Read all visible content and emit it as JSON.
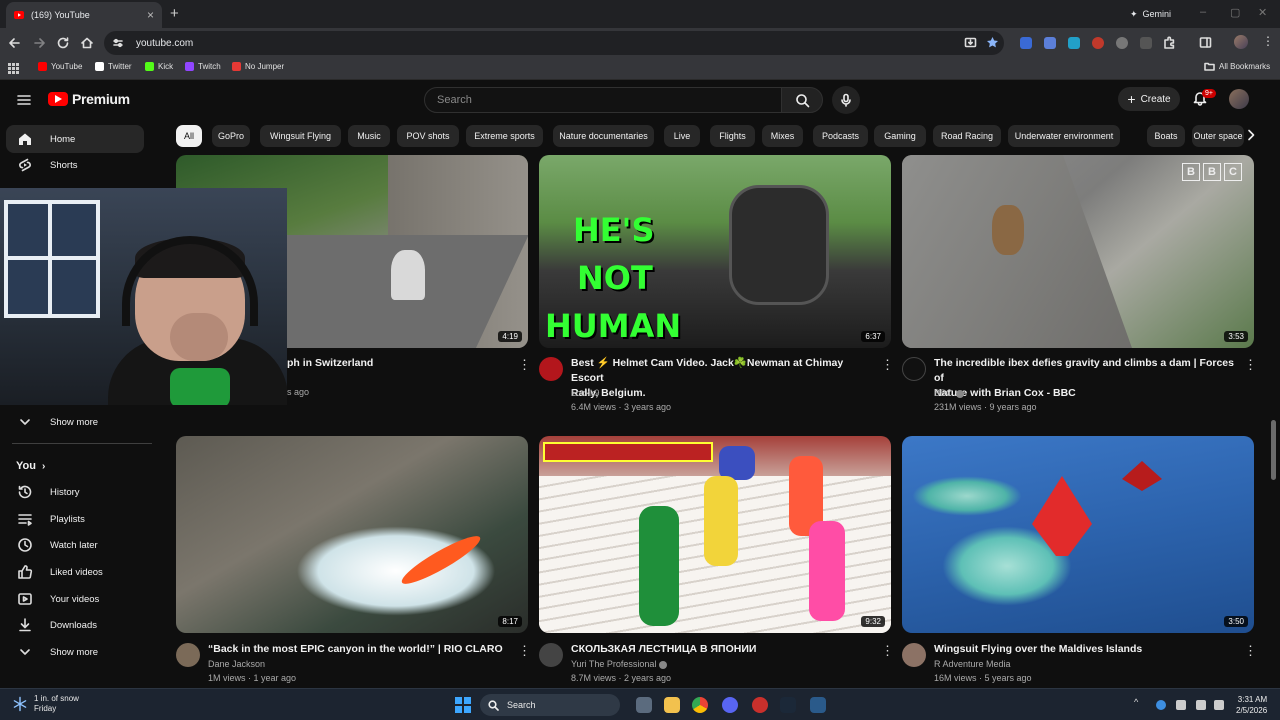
{
  "browser": {
    "tab_title": "(169) YouTube",
    "url": "youtube.com",
    "gemini_label": "Gemini",
    "bookmarks": [
      {
        "label": "YouTube",
        "color": "#ff0000"
      },
      {
        "label": "Twitter",
        "color": "#ffffff"
      },
      {
        "label": "Kick",
        "color": "#53fc18"
      },
      {
        "label": "Twitch",
        "color": "#9146ff"
      },
      {
        "label": "No Jumper",
        "color": "#e53935"
      }
    ],
    "all_bookmarks": "All Bookmarks"
  },
  "youtube": {
    "logo_text": "Premium",
    "search_placeholder": "Search",
    "create_label": "Create",
    "notification_count": "9+",
    "accent": "#ff0000"
  },
  "sidebar": {
    "top": [
      {
        "label": "Home",
        "icon": "home-icon"
      },
      {
        "label": "Shorts",
        "icon": "shorts-icon"
      }
    ],
    "show_more_1": "Show more",
    "you_label": "You",
    "you_items": [
      {
        "label": "History",
        "icon": "history-icon"
      },
      {
        "label": "Playlists",
        "icon": "playlists-icon"
      },
      {
        "label": "Watch later",
        "icon": "clock-icon"
      },
      {
        "label": "Liked videos",
        "icon": "thumbs-up-icon"
      },
      {
        "label": "Your videos",
        "icon": "video-icon"
      },
      {
        "label": "Downloads",
        "icon": "download-icon"
      }
    ],
    "show_more_2": "Show more"
  },
  "chips": [
    "All",
    "GoPro",
    "Wingsuit Flying",
    "Music",
    "POV shots",
    "Extreme sports",
    "Nature documentaries",
    "Live",
    "Flights",
    "Mixes",
    "Podcasts",
    "Gaming",
    "Road Racing",
    "Underwater environment",
    "Boats",
    "Outer space"
  ],
  "videos": [
    {
      "title": "ph in Switzerland",
      "title2": "",
      "channel": "",
      "meta": "s ago",
      "duration": "4:19"
    },
    {
      "title": "Best ⚡ Helmet Cam Video. Jack☘️Newman at Chimay Escort",
      "title2": "Rally, Belgium.",
      "channel": "Lockk9",
      "meta": "6.4M views · 3 years ago",
      "duration": "6:37",
      "overlay": [
        "HE'S",
        "NOT",
        "HUMAN"
      ]
    },
    {
      "title": "The incredible ibex defies gravity and climbs a dam | Forces of",
      "title2": "Nature with Brian Cox - BBC",
      "channel": "BBC",
      "meta": "231M views · 9 years ago",
      "duration": "3:53"
    },
    {
      "title": "“Back in the most EPIC canyon in the world!” | RIO CLARO",
      "title2": "",
      "channel": "Dane Jackson",
      "meta": "1M views · 1 year ago",
      "duration": "8:17"
    },
    {
      "title": "СКОЛЬЗКАЯ ЛЕСТНИЦА В ЯПОНИИ",
      "title2": "",
      "channel": "Yuri The Professional",
      "meta": "8.7M views · 2 years ago",
      "duration": "9:32"
    },
    {
      "title": "Wingsuit Flying over the Maldives Islands",
      "title2": "",
      "channel": "R Adventure Media",
      "meta": "16M views · 5 years ago",
      "duration": "3:50"
    }
  ],
  "taskbar": {
    "weather_line1": "1 in. of snow",
    "weather_line2": "Friday",
    "search_label": "Search",
    "time": "3:31 AM",
    "date": "2/5/2026"
  }
}
